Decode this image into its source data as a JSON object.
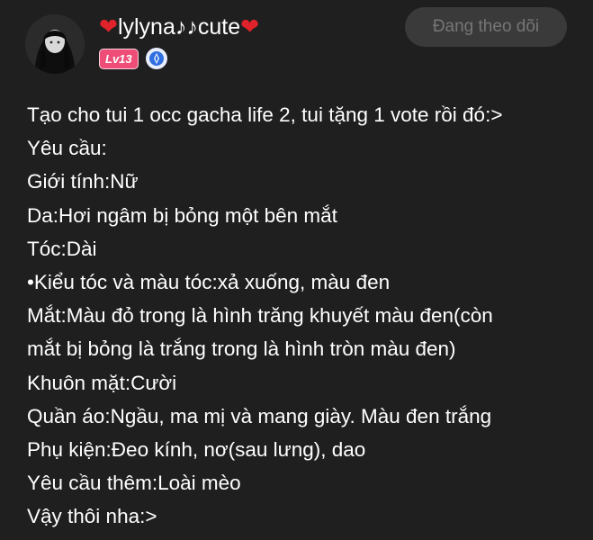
{
  "header": {
    "username": "lylyna♪♪cute",
    "heart_left": "❤",
    "heart_right": "❤",
    "level": "Lv13",
    "follow_label": "Đang theo dõi"
  },
  "icons": {
    "avatar": "avatar",
    "verified": "verified-badge-icon"
  },
  "colors": {
    "background": "#1f1f1f",
    "heart": "#e0222b",
    "level_badge": "#ee4d78",
    "verified": "#2f6fe0",
    "follow_button_bg": "#3a3a3a",
    "follow_button_text": "#767676"
  },
  "post": {
    "lines": [
      "Tạo cho tui 1 occ gacha life 2, tui tặng 1 vote rồi đó:>",
      "Yêu cầu:",
      "Giới tính:Nữ",
      "Da:Hơi ngâm bị bỏng một bên mắt",
      "Tóc:Dài",
      "•Kiểu tóc và màu tóc:xả xuống, màu đen",
      "Mắt:Màu đỏ trong là hình trăng khuyết màu đen(còn",
      "mắt bị bỏng là trắng trong là hình tròn màu đen)",
      "Khuôn mặt:Cười",
      "Quần áo:Ngầu, ma mị và mang giày. Màu đen trắng",
      "Phụ kiện:Đeo kính, nơ(sau lưng), dao",
      "Yêu cầu thêm:Loài mèo",
      "Vậy thôi nha:>"
    ]
  }
}
